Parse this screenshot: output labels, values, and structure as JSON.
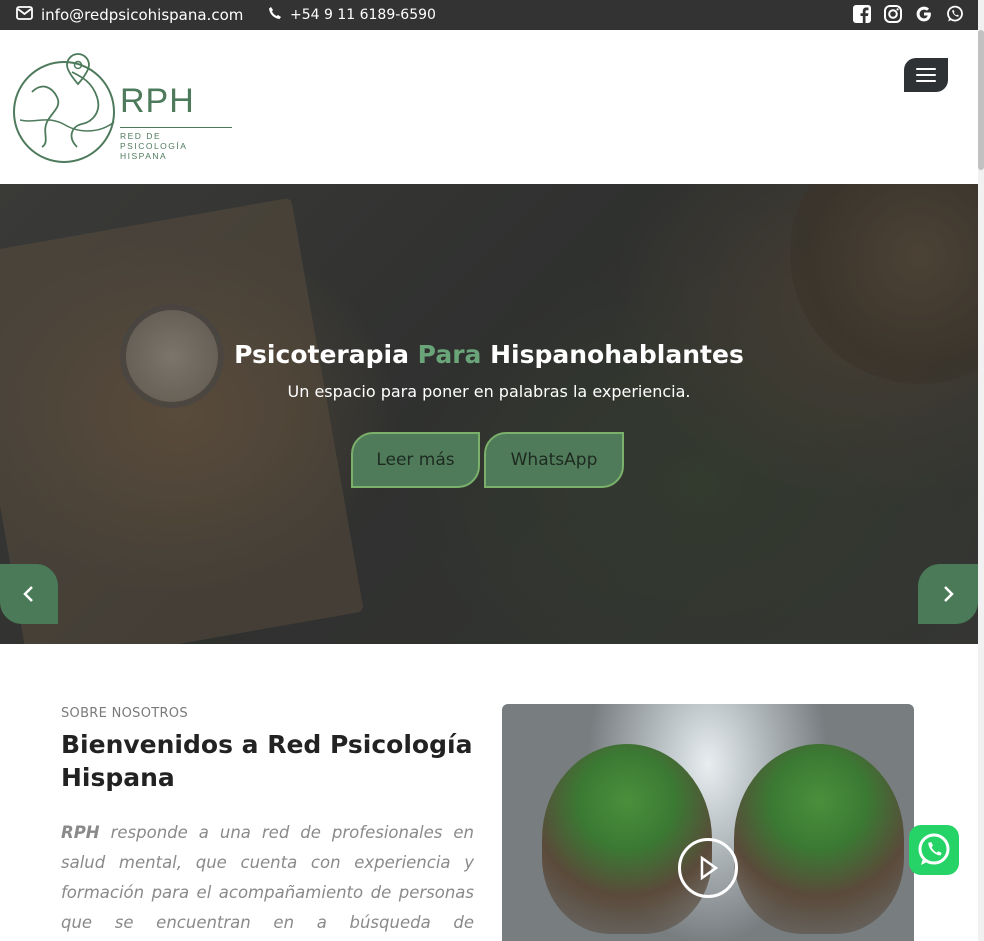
{
  "topbar": {
    "email": "info@redpsicohispana.com",
    "phone": "+54 9 11 6189-6590",
    "socials": [
      "facebook-icon",
      "instagram-icon",
      "google-icon",
      "whatsapp-icon"
    ]
  },
  "header": {
    "logo_title": "RPH",
    "logo_subtitle_1": "RED DE PSICOLOGÍA",
    "logo_subtitle_2": "HISPANA"
  },
  "hero": {
    "title_part1": "Psicoterapia",
    "title_accent": "Para",
    "title_part2": "Hispanohablantes",
    "subtitle": "Un espacio para poner en palabras la experiencia.",
    "button_more": "Leer más",
    "button_whatsapp": "WhatsApp"
  },
  "about": {
    "kicker": "SOBRE NOSOTROS",
    "title": "Bienvenidos a Red Psicología Hispana",
    "text_brand": "RPH",
    "text_body": " responde a una red de profesionales en salud mental, que cuenta con experiencia y formación para el acompañamiento de personas que se encuentran en a búsqueda de"
  },
  "colors": {
    "brand_green": "#4f7b5b",
    "accent_green": "#6aa57a",
    "topbar": "#333333",
    "whatsapp": "#25d366"
  }
}
